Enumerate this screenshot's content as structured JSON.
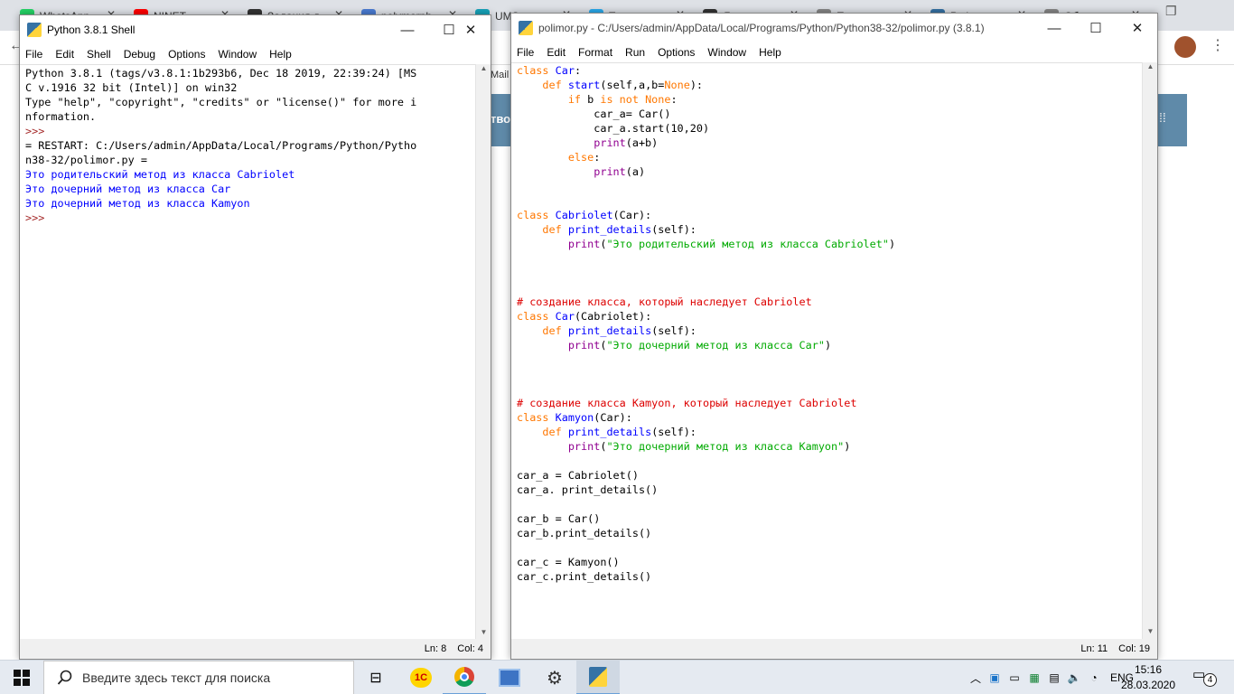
{
  "browser": {
    "tabs": [
      {
        "label": "WhatsApp",
        "color": "#25d366"
      },
      {
        "label": "NINET",
        "color": "#ff0000"
      },
      {
        "label": "Задания д",
        "color": "#333333"
      },
      {
        "label": "polymorph",
        "color": "#4a7bd0"
      },
      {
        "label": "UMS",
        "color": "#17a2b8"
      },
      {
        "label": "Т",
        "color": "#2aabee"
      },
      {
        "label": "Я",
        "color": "#333333"
      },
      {
        "label": "П",
        "color": "#888888"
      },
      {
        "label": "Python",
        "color": "#3572a5"
      },
      {
        "label": "Об",
        "color": "#888888"
      }
    ],
    "bookmark_label": "Mail",
    "banner_text": "тво"
  },
  "shell": {
    "title": "Python 3.8.1 Shell",
    "menu": [
      "File",
      "Edit",
      "Shell",
      "Debug",
      "Options",
      "Window",
      "Help"
    ],
    "lines": [
      {
        "text": "Python 3.8.1 (tags/v3.8.1:1b293b6, Dec 18 2019, 22:39:24) [MS",
        "kind": "plain"
      },
      {
        "text": "C v.1916 32 bit (Intel)] on win32",
        "kind": "plain"
      },
      {
        "text": "Type \"help\", \"copyright\", \"credits\" or \"license()\" for more i",
        "kind": "plain"
      },
      {
        "text": "nformation.",
        "kind": "plain"
      },
      {
        "text": ">>>",
        "kind": "prompt"
      },
      {
        "text": "= RESTART: C:/Users/admin/AppData/Local/Programs/Python/Pytho",
        "kind": "plain"
      },
      {
        "text": "n38-32/polimor.py =",
        "kind": "plain"
      },
      {
        "text": "Это родительский метод из класса Cabriolet",
        "kind": "out"
      },
      {
        "text": "Это дочерний метод из класса Car",
        "kind": "out"
      },
      {
        "text": "Это дочерний метод из класса Kamyon",
        "kind": "out"
      },
      {
        "text": ">>>",
        "kind": "prompt"
      }
    ],
    "status": {
      "line": "Ln: 8",
      "col": "Col: 4"
    }
  },
  "editor": {
    "title": "polimor.py - C:/Users/admin/AppData/Local/Programs/Python/Python38-32/polimor.py (3.8.1)",
    "menu": [
      "File",
      "Edit",
      "Format",
      "Run",
      "Options",
      "Window",
      "Help"
    ],
    "code": [
      [
        [
          "kw",
          "class "
        ],
        [
          "fn",
          "Car"
        ],
        [
          "",
          ":"
        ]
      ],
      [
        [
          "",
          "    "
        ],
        [
          "kw",
          "def "
        ],
        [
          "fn",
          "start"
        ],
        [
          "",
          "(self,a,b="
        ],
        [
          "kw",
          "None"
        ],
        [
          "",
          "):"
        ]
      ],
      [
        [
          "",
          "        "
        ],
        [
          "kw",
          "if "
        ],
        [
          "",
          "b "
        ],
        [
          "kw",
          "is not None"
        ],
        [
          "",
          ":"
        ]
      ],
      [
        [
          "",
          "            car_a= Car()"
        ]
      ],
      [
        [
          "",
          "            car_a.start(10,20)"
        ]
      ],
      [
        [
          "",
          "            "
        ],
        [
          "bi",
          "print"
        ],
        [
          "",
          "(a+b)"
        ]
      ],
      [
        [
          "",
          "        "
        ],
        [
          "kw",
          "else"
        ],
        [
          "",
          ":"
        ]
      ],
      [
        [
          "",
          "            "
        ],
        [
          "bi",
          "print"
        ],
        [
          "",
          "(a)"
        ]
      ],
      [],
      [],
      [
        [
          "kw",
          "class "
        ],
        [
          "fn",
          "Cabriolet"
        ],
        [
          "",
          "(Car):"
        ]
      ],
      [
        [
          "",
          "    "
        ],
        [
          "kw",
          "def "
        ],
        [
          "fn",
          "print_details"
        ],
        [
          "",
          "(self):"
        ]
      ],
      [
        [
          "",
          "        "
        ],
        [
          "bi",
          "print"
        ],
        [
          "",
          "("
        ],
        [
          "st",
          "\"Это родительский метод из класса Cabriolet\""
        ],
        [
          "",
          ")"
        ]
      ],
      [],
      [],
      [],
      [
        [
          "cm",
          "# создание класса, который наследует Cabriolet"
        ]
      ],
      [
        [
          "kw",
          "class "
        ],
        [
          "fn",
          "Car"
        ],
        [
          "",
          "(Cabriolet):"
        ]
      ],
      [
        [
          "",
          "    "
        ],
        [
          "kw",
          "def "
        ],
        [
          "fn",
          "print_details"
        ],
        [
          "",
          "(self):"
        ]
      ],
      [
        [
          "",
          "        "
        ],
        [
          "bi",
          "print"
        ],
        [
          "",
          "("
        ],
        [
          "st",
          "\"Это дочерний метод из класса Car\""
        ],
        [
          "",
          ")"
        ]
      ],
      [],
      [],
      [],
      [
        [
          "cm",
          "# создание класса Kamyon, который наследует Cabriolet"
        ]
      ],
      [
        [
          "kw",
          "class "
        ],
        [
          "fn",
          "Kamyon"
        ],
        [
          "",
          "(Car):"
        ]
      ],
      [
        [
          "",
          "    "
        ],
        [
          "kw",
          "def "
        ],
        [
          "fn",
          "print_details"
        ],
        [
          "",
          "(self):"
        ]
      ],
      [
        [
          "",
          "        "
        ],
        [
          "bi",
          "print"
        ],
        [
          "",
          "("
        ],
        [
          "st",
          "\"Это дочерний метод из класса Kamyon\""
        ],
        [
          "",
          ")"
        ]
      ],
      [],
      [
        [
          "",
          "car_a = Cabriolet()"
        ]
      ],
      [
        [
          "",
          "car_a. print_details()"
        ]
      ],
      [],
      [
        [
          "",
          "car_b = Car()"
        ]
      ],
      [
        [
          "",
          "car_b.print_details()"
        ]
      ],
      [],
      [
        [
          "",
          "car_c = Kamyon()"
        ]
      ],
      [
        [
          "",
          "car_c.print_details()"
        ]
      ]
    ],
    "status": {
      "line": "Ln: 11",
      "col": "Col: 19"
    }
  },
  "taskbar": {
    "search_placeholder": "Введите здесь текст для поиска",
    "lang": "ENG",
    "time": "15:16",
    "date": "28.03.2020",
    "notifications": "4"
  }
}
